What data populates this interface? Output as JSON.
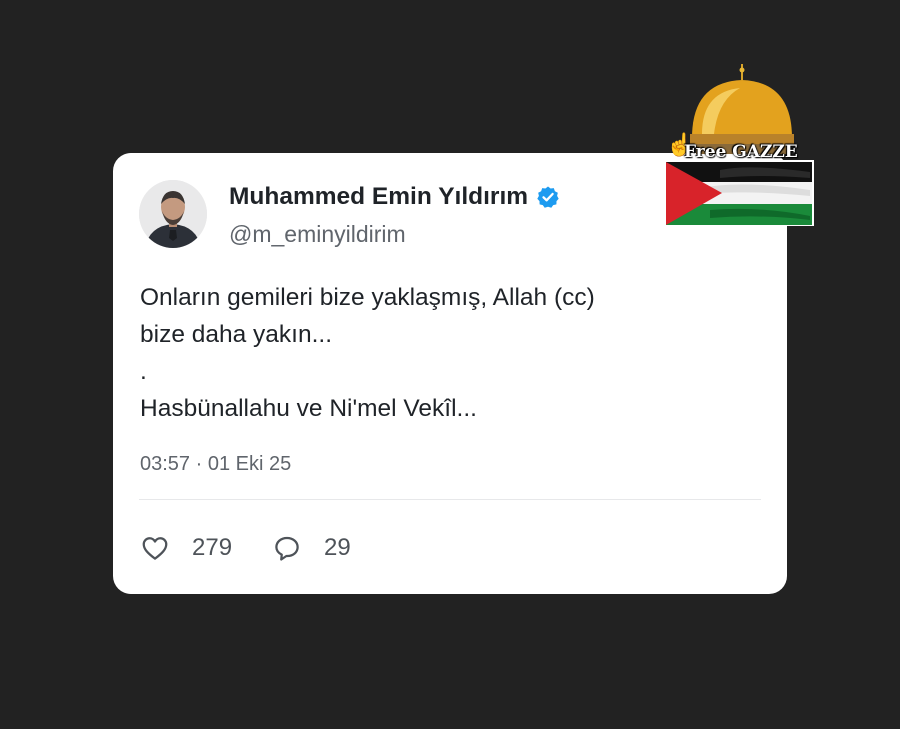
{
  "tweet": {
    "author": {
      "name": "Muhammed Emin Yıldırım",
      "handle": "@m_eminyildirim",
      "verified": true,
      "avatar_icon": "profile-photo"
    },
    "text_lines": [
      "Onların gemileri bize yaklaşmış, Allah (cc)",
      "bize daha yakın...",
      ".",
      "Hasbünallahu ve Ni'mel Vekîl..."
    ],
    "timestamp": "03:57 · 01 Eki 25",
    "actions": {
      "likes": {
        "icon": "heart-icon",
        "count": "279"
      },
      "replies": {
        "icon": "comment-icon",
        "count": "29"
      }
    }
  },
  "overlay": {
    "text": "Free GAZZE",
    "icons": [
      "pointing-finger-icon",
      "dome-of-the-rock-icon",
      "palestine-flag"
    ]
  },
  "colors": {
    "background": "#222222",
    "card": "#ffffff",
    "verified_blue": "#1d9bf0",
    "text_primary": "#1f2328",
    "text_secondary": "#60656c"
  }
}
